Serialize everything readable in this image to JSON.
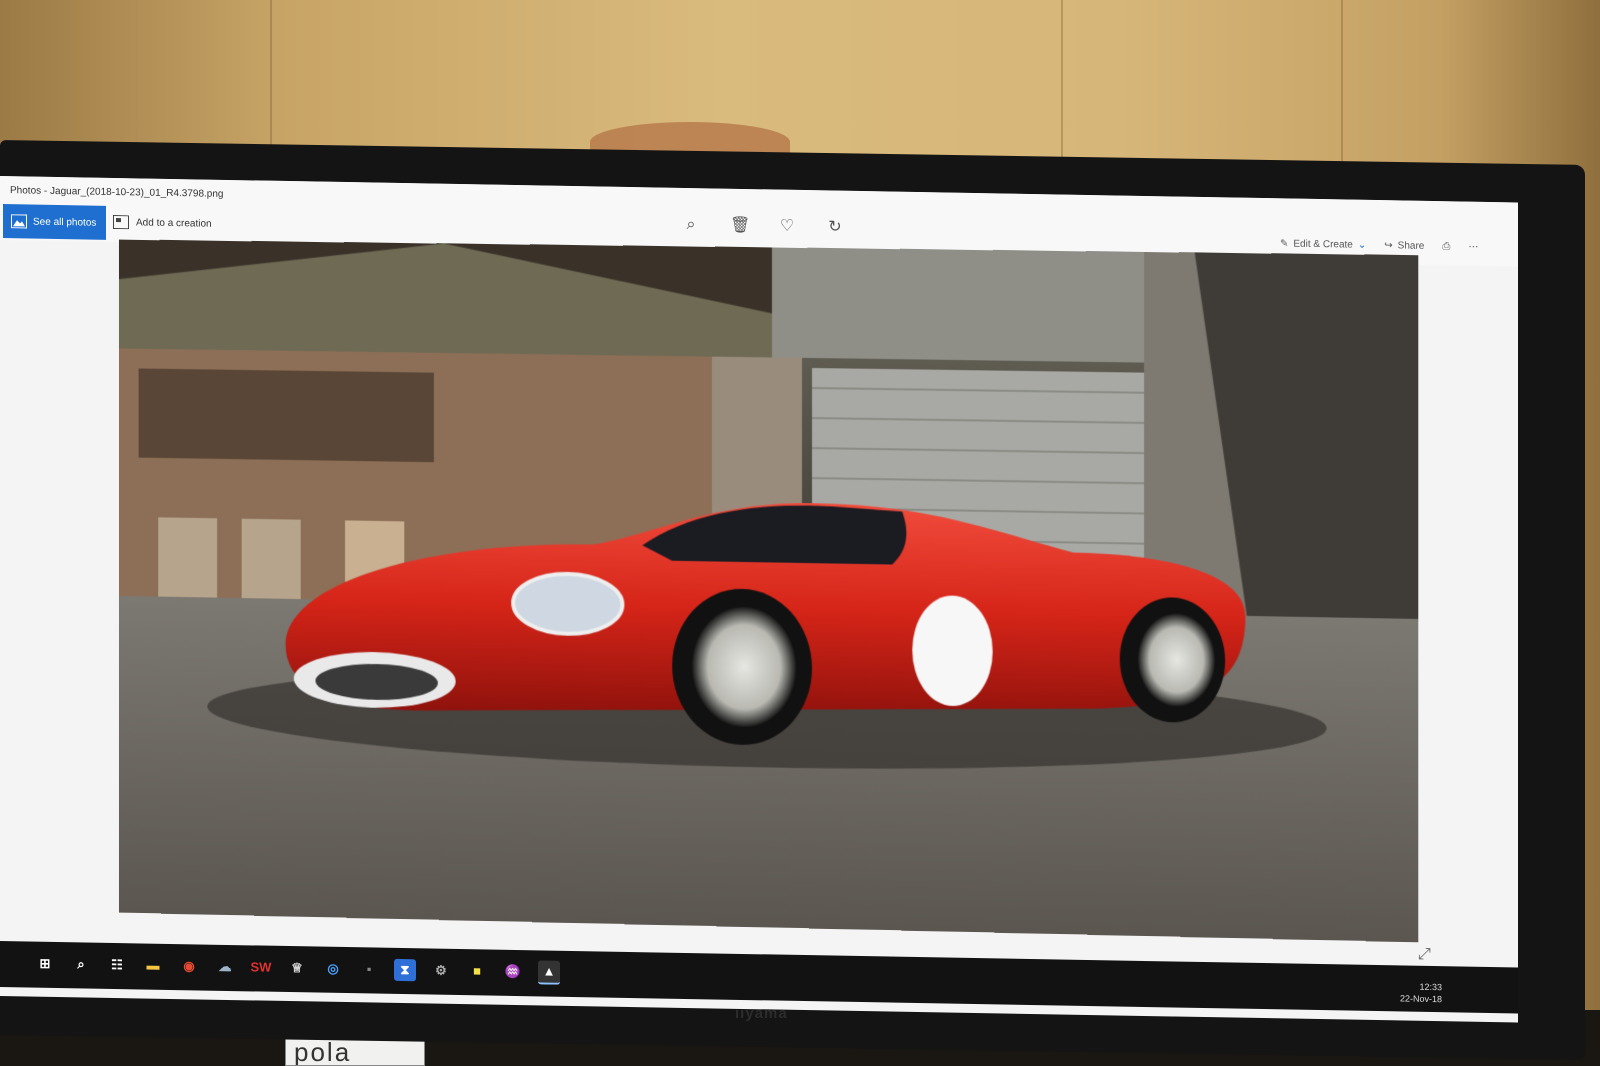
{
  "window": {
    "title": "Photos - Jaguar_(2018-10-23)_01_R4.3798.png",
    "minimize_glyph": "–",
    "restore_glyph": "❐",
    "close_glyph": "✕"
  },
  "toolbar": {
    "see_all_label": "See all photos",
    "add_creation_label": "Add to a creation",
    "center_tools": [
      {
        "icon": "zoom-icon",
        "glyph": "⌕"
      },
      {
        "icon": "delete-icon",
        "glyph": "🗑"
      },
      {
        "icon": "favorite-icon",
        "glyph": "♡"
      },
      {
        "icon": "rotate-icon",
        "glyph": "↻"
      }
    ],
    "edit_create_label": "Edit & Create",
    "share_label": "Share",
    "print_glyph": "⎙",
    "more_glyph": "⋯"
  },
  "viewer": {
    "expand_glyph": "⤢"
  },
  "taskbar": {
    "icons": [
      {
        "name": "start-icon",
        "glyph": "⊞",
        "color": "#ffffff",
        "bg": "transparent"
      },
      {
        "name": "search-icon",
        "glyph": "⌕",
        "color": "#ffffff",
        "bg": "transparent"
      },
      {
        "name": "task-view-icon",
        "glyph": "☷",
        "color": "#ffffff",
        "bg": "transparent"
      },
      {
        "name": "file-explorer-icon",
        "glyph": "▬",
        "color": "#f4c542",
        "bg": "transparent"
      },
      {
        "name": "chrome-icon",
        "glyph": "◉",
        "color": "#e44b33",
        "bg": "transparent"
      },
      {
        "name": "app-icon",
        "glyph": "☁",
        "color": "#9fb4c8",
        "bg": "transparent"
      },
      {
        "name": "solidworks-icon",
        "glyph": "SW",
        "color": "#e03030",
        "bg": "transparent"
      },
      {
        "name": "rhino-icon",
        "glyph": "♕",
        "color": "#d8d8d8",
        "bg": "transparent"
      },
      {
        "name": "browser-icon",
        "glyph": "◎",
        "color": "#4aa3ff",
        "bg": "transparent"
      },
      {
        "name": "app2-icon",
        "glyph": "▪",
        "color": "#888888",
        "bg": "transparent"
      },
      {
        "name": "app3-icon",
        "glyph": "⧗",
        "color": "#ffffff",
        "bg": "#2f6fd8"
      },
      {
        "name": "app4-icon",
        "glyph": "⚙",
        "color": "#aaaaaa",
        "bg": "transparent"
      },
      {
        "name": "sticky-notes-icon",
        "glyph": "■",
        "color": "#f5e04a",
        "bg": "transparent"
      },
      {
        "name": "acrobat-icon",
        "glyph": "♒",
        "color": "#e22b2b",
        "bg": "transparent"
      },
      {
        "name": "photos-icon",
        "glyph": "▲",
        "color": "#ffffff",
        "bg": "#333333"
      }
    ],
    "time": "12:33",
    "date": "22-Nov-18"
  },
  "monitor": {
    "brand": "iiyama"
  },
  "desk": {
    "card_text": "pola"
  }
}
